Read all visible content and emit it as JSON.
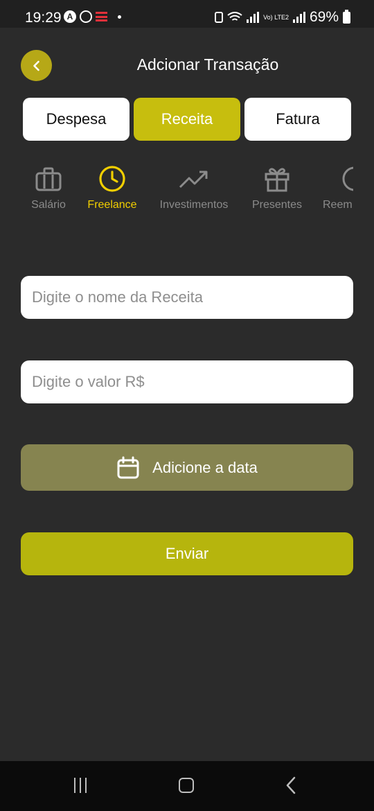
{
  "status_bar": {
    "time": "19:29",
    "battery": "69%",
    "volte": "Vo) LTE2"
  },
  "header": {
    "title": "Adcionar Transação",
    "back_icon": "chevron-left-icon"
  },
  "tabs": [
    {
      "label": "Despesa",
      "active": false
    },
    {
      "label": "Receita",
      "active": true
    },
    {
      "label": "Fatura",
      "active": false
    }
  ],
  "categories": [
    {
      "label": "Salário",
      "icon": "briefcase-icon",
      "active": false
    },
    {
      "label": "Freelance",
      "icon": "clock-icon",
      "active": true
    },
    {
      "label": "Investimentos",
      "icon": "trending-up-icon",
      "active": false
    },
    {
      "label": "Presentes",
      "icon": "gift-icon",
      "active": false
    },
    {
      "label": "Reem",
      "icon": "partial-circle-icon",
      "active": false
    }
  ],
  "form": {
    "name_placeholder": "Digite o nome da Receita",
    "value_placeholder": "Digite o valor R$",
    "date_button": "Adicione a data",
    "submit_button": "Enviar"
  },
  "colors": {
    "background": "#2b2b2b",
    "accent": "#c7be0e",
    "active_category": "#f2cf00",
    "date_button": "#868450",
    "submit_button": "#b6b50d"
  }
}
